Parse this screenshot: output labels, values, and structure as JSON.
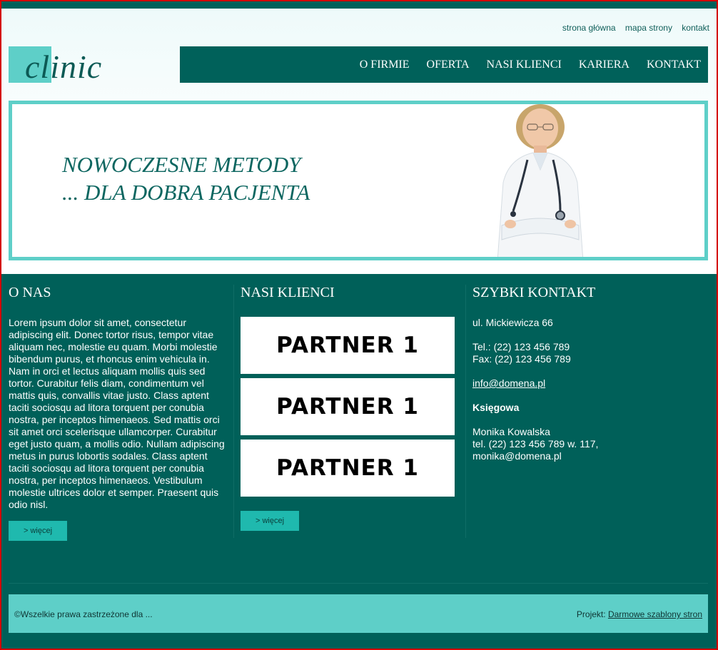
{
  "util_nav": [
    "strona główna",
    "mapa strony",
    "kontakt"
  ],
  "logo": {
    "text": "clinic"
  },
  "main_nav": [
    "O FIRMIE",
    "OFERTA",
    "NASI KLIENCI",
    "KARIERA",
    "KONTAKT"
  ],
  "banner": {
    "line1": "NOWOCZESNE METODY",
    "line2": "... DLA DOBRA PACJENTA"
  },
  "about": {
    "title": "O NAS",
    "text": "Lorem ipsum dolor sit amet, consectetur adipiscing elit. Donec tortor risus, tempor vitae aliquam nec, molestie eu quam. Morbi molestie bibendum purus, et rhoncus enim vehicula in. Nam in orci et lectus aliquam mollis quis sed tortor. Curabitur felis diam, condimentum vel mattis quis, convallis vitae justo. Class aptent taciti sociosqu ad litora torquent per conubia nostra, per inceptos himenaeos. Sed mattis orci sit amet orci scelerisque ullamcorper. Curabitur eget justo quam, a mollis odio. Nullam adipiscing metus in purus lobortis sodales. Class aptent taciti sociosqu ad litora torquent per conubia nostra, per inceptos himenaeos. Vestibulum molestie ultrices dolor et semper. Praesent quis odio nisl.",
    "more": "> więcej"
  },
  "clients": {
    "title": "NASI KLIENCI",
    "partners": [
      "PARTNER 1",
      "PARTNER 1",
      "PARTNER 1"
    ],
    "more": "> więcej"
  },
  "contact": {
    "title": "SZYBKI KONTAKT",
    "address": "ul. Mickiewicza 66",
    "tel": "Tel.: (22) 123 456 789",
    "fax": "Fax: (22) 123 456 789",
    "email": "info@domena.pl",
    "dept": "Księgowa",
    "person": "Monika Kowalska",
    "person_tel": "tel. (22) 123 456 789 w. 117,",
    "person_email": "monika@domena.pl"
  },
  "footer": {
    "copyright": "©Wszelkie prawa zastrzeżone dla ...",
    "project_label": "Projekt:",
    "project_link": "Darmowe szablony stron"
  }
}
